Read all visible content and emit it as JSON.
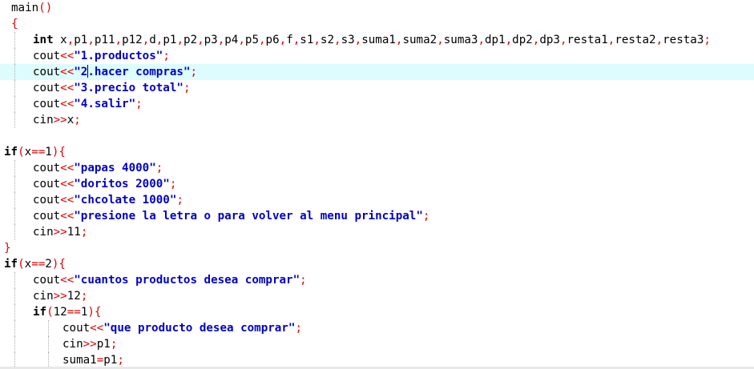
{
  "editor": {
    "current_line_color": "#ddfcfd",
    "colors": {
      "keyword": "#000000",
      "operator": "#e00000",
      "string": "#0000c8",
      "identifier": "#000000"
    },
    "lines": [
      {
        "indent": 1,
        "tokens": [
          [
            "id",
            "main"
          ],
          [
            "op",
            "()"
          ]
        ]
      },
      {
        "indent": 1,
        "tokens": [
          [
            "op",
            "{"
          ]
        ]
      },
      {
        "indent": 2,
        "guides": 1,
        "tokens": [
          [
            "kw",
            "int"
          ],
          [
            "id",
            " x"
          ],
          [
            "op",
            ","
          ],
          [
            "id",
            "p1"
          ],
          [
            "op",
            ","
          ],
          [
            "id",
            "p11"
          ],
          [
            "op",
            ","
          ],
          [
            "id",
            "p12"
          ],
          [
            "op",
            ","
          ],
          [
            "id",
            "d"
          ],
          [
            "op",
            ","
          ],
          [
            "id",
            "p1"
          ],
          [
            "op",
            ","
          ],
          [
            "id",
            "p2"
          ],
          [
            "op",
            ","
          ],
          [
            "id",
            "p3"
          ],
          [
            "op",
            ","
          ],
          [
            "id",
            "p4"
          ],
          [
            "op",
            ","
          ],
          [
            "id",
            "p5"
          ],
          [
            "op",
            ","
          ],
          [
            "id",
            "p6"
          ],
          [
            "op",
            ","
          ],
          [
            "id",
            "f"
          ],
          [
            "op",
            ","
          ],
          [
            "id",
            "s1"
          ],
          [
            "op",
            ","
          ],
          [
            "id",
            "s2"
          ],
          [
            "op",
            ","
          ],
          [
            "id",
            "s3"
          ],
          [
            "op",
            ","
          ],
          [
            "id",
            "suma1"
          ],
          [
            "op",
            ","
          ],
          [
            "id",
            "suma2"
          ],
          [
            "op",
            ","
          ],
          [
            "id",
            "suma3"
          ],
          [
            "op",
            ","
          ],
          [
            "id",
            "dp1"
          ],
          [
            "op",
            ","
          ],
          [
            "id",
            "dp2"
          ],
          [
            "op",
            ","
          ],
          [
            "id",
            "dp3"
          ],
          [
            "op",
            ","
          ],
          [
            "id",
            "resta1"
          ],
          [
            "op",
            ","
          ],
          [
            "id",
            "resta2"
          ],
          [
            "op",
            ","
          ],
          [
            "id",
            "resta3"
          ],
          [
            "op",
            ";"
          ]
        ]
      },
      {
        "indent": 2,
        "guides": 1,
        "tokens": [
          [
            "id",
            "cout"
          ],
          [
            "op",
            "<<"
          ],
          [
            "str",
            "\"1.productos\""
          ],
          [
            "op",
            ";"
          ]
        ]
      },
      {
        "indent": 2,
        "guides": 1,
        "current": true,
        "tokens": [
          [
            "id",
            "cout"
          ],
          [
            "op",
            "<<"
          ],
          [
            "str",
            "\"2"
          ],
          [
            "caret",
            ""
          ],
          [
            "str",
            ".hacer compras\""
          ],
          [
            "op",
            ";"
          ]
        ]
      },
      {
        "indent": 2,
        "guides": 1,
        "tokens": [
          [
            "id",
            "cout"
          ],
          [
            "op",
            "<<"
          ],
          [
            "str",
            "\"3.precio total\""
          ],
          [
            "op",
            ";"
          ]
        ]
      },
      {
        "indent": 2,
        "guides": 1,
        "tokens": [
          [
            "id",
            "cout"
          ],
          [
            "op",
            "<<"
          ],
          [
            "str",
            "\"4.salir\""
          ],
          [
            "op",
            ";"
          ]
        ]
      },
      {
        "indent": 2,
        "guides": 1,
        "tokens": [
          [
            "id",
            "cin"
          ],
          [
            "op",
            ">>"
          ],
          [
            "id",
            "x"
          ],
          [
            "op",
            ";"
          ]
        ]
      },
      {
        "indent": 0,
        "tokens": []
      },
      {
        "indent": 0,
        "tokens": [
          [
            "kw",
            "if"
          ],
          [
            "op",
            "("
          ],
          [
            "id",
            "x"
          ],
          [
            "op",
            "=="
          ],
          [
            "num",
            "1"
          ],
          [
            "op",
            "){"
          ]
        ]
      },
      {
        "indent": 2,
        "guides": 1,
        "tokens": [
          [
            "id",
            "cout"
          ],
          [
            "op",
            "<<"
          ],
          [
            "str",
            "\"papas 4000\""
          ],
          [
            "op",
            ";"
          ]
        ]
      },
      {
        "indent": 2,
        "guides": 1,
        "tokens": [
          [
            "id",
            "cout"
          ],
          [
            "op",
            "<<"
          ],
          [
            "str",
            "\"doritos 2000\""
          ],
          [
            "op",
            ";"
          ]
        ]
      },
      {
        "indent": 2,
        "guides": 1,
        "tokens": [
          [
            "id",
            "cout"
          ],
          [
            "op",
            "<<"
          ],
          [
            "str",
            "\"chcolate 1000\""
          ],
          [
            "op",
            ";"
          ]
        ]
      },
      {
        "indent": 2,
        "guides": 1,
        "tokens": [
          [
            "id",
            "cout"
          ],
          [
            "op",
            "<<"
          ],
          [
            "str",
            "\"presione la letra o para volver al menu principal\""
          ],
          [
            "op",
            ";"
          ]
        ]
      },
      {
        "indent": 2,
        "guides": 1,
        "tokens": [
          [
            "id",
            "cin"
          ],
          [
            "op",
            ">>"
          ],
          [
            "id",
            "11"
          ],
          [
            "op",
            ";"
          ]
        ]
      },
      {
        "indent": 0,
        "tokens": [
          [
            "op",
            "}"
          ]
        ]
      },
      {
        "indent": 0,
        "tokens": [
          [
            "kw",
            "if"
          ],
          [
            "op",
            "("
          ],
          [
            "id",
            "x"
          ],
          [
            "op",
            "=="
          ],
          [
            "num",
            "2"
          ],
          [
            "op",
            "){"
          ]
        ]
      },
      {
        "indent": 2,
        "guides": 1,
        "tokens": [
          [
            "id",
            "cout"
          ],
          [
            "op",
            "<<"
          ],
          [
            "str",
            "\"cuantos productos desea comprar\""
          ],
          [
            "op",
            ";"
          ]
        ]
      },
      {
        "indent": 2,
        "guides": 1,
        "tokens": [
          [
            "id",
            "cin"
          ],
          [
            "op",
            ">>"
          ],
          [
            "id",
            "12"
          ],
          [
            "op",
            ";"
          ]
        ]
      },
      {
        "indent": 2,
        "guides": 1,
        "tokens": [
          [
            "kw",
            "if"
          ],
          [
            "op",
            "("
          ],
          [
            "id",
            "12"
          ],
          [
            "op",
            "=="
          ],
          [
            "num",
            "1"
          ],
          [
            "op",
            "){"
          ]
        ]
      },
      {
        "indent": 3,
        "guides": 2,
        "tokens": [
          [
            "id",
            "cout"
          ],
          [
            "op",
            "<<"
          ],
          [
            "str",
            "\"que producto desea comprar\""
          ],
          [
            "op",
            ";"
          ]
        ]
      },
      {
        "indent": 3,
        "guides": 2,
        "tokens": [
          [
            "id",
            "cin"
          ],
          [
            "op",
            ">>"
          ],
          [
            "id",
            "p1"
          ],
          [
            "op",
            ";"
          ]
        ]
      },
      {
        "indent": 3,
        "guides": 2,
        "tokens": [
          [
            "id",
            "suma1"
          ],
          [
            "op",
            "="
          ],
          [
            "id",
            "p1"
          ],
          [
            "op",
            ";"
          ]
        ]
      }
    ]
  }
}
